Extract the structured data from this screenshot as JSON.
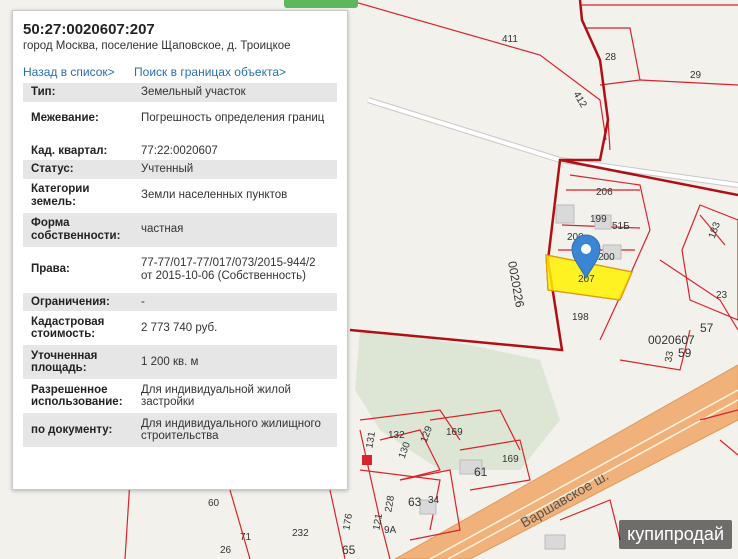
{
  "object": {
    "cadastral_number": "50:27:0020607:207",
    "address": "город Москва, поселение Щаповское, д. Троицкое"
  },
  "links": {
    "back_to_list": "Назад в список>",
    "search_in_bounds": "Поиск в границах объекта>"
  },
  "properties": {
    "type_key": "Тип:",
    "type_val": "Земельный участок",
    "survey_key": "Межевание:",
    "survey_val": "Погрешность определения границ",
    "quarter_key": "Кад. квартал:",
    "quarter_val": "77:22:0020607",
    "status_key": "Статус:",
    "status_val": "Учтенный",
    "category_key": "Категории земель:",
    "category_val": "Земли населенных пунктов",
    "ownership_key": "Форма собственности:",
    "ownership_val": "частная",
    "rights_key": "Права:",
    "rights_val": "77-77/017-77/017/073/2015-944/2 от 2015-10-06 (Собственность)",
    "restrictions_key": "Ограничения:",
    "restrictions_val": "-",
    "cost_key": "Кадастровая стоимость:",
    "cost_val": "2 773 740 руб.",
    "area_key": "Уточненная площадь:",
    "area_val": "1 200 кв. м",
    "permitted_key": "Разрешенное использование:",
    "permitted_val": "Для индивидуальной жилой застройки",
    "document_key": "по документу:",
    "document_val": "Для индивидуального жилищного строительства"
  },
  "map": {
    "parcel_labels": [
      "411",
      "28",
      "29",
      "412",
      "206",
      "199",
      "51Б",
      "200",
      "200",
      "207",
      "198",
      "183",
      "23",
      "57",
      "59",
      "33",
      "169",
      "61",
      "169",
      "132",
      "129",
      "130",
      "131",
      "60",
      "71",
      "26",
      "232",
      "176",
      "121",
      "9А",
      "228",
      "63",
      "34",
      "65"
    ],
    "quarter_labels": [
      "0020226",
      "0020607"
    ],
    "road_label": "Варшавское ш.",
    "colors": {
      "boundary": "#d8242b",
      "selected_fill": "#fff200",
      "marker": "#3a86d4",
      "road": "#e8a567",
      "green": "#dfe8d8"
    }
  },
  "watermark": "купипродай"
}
